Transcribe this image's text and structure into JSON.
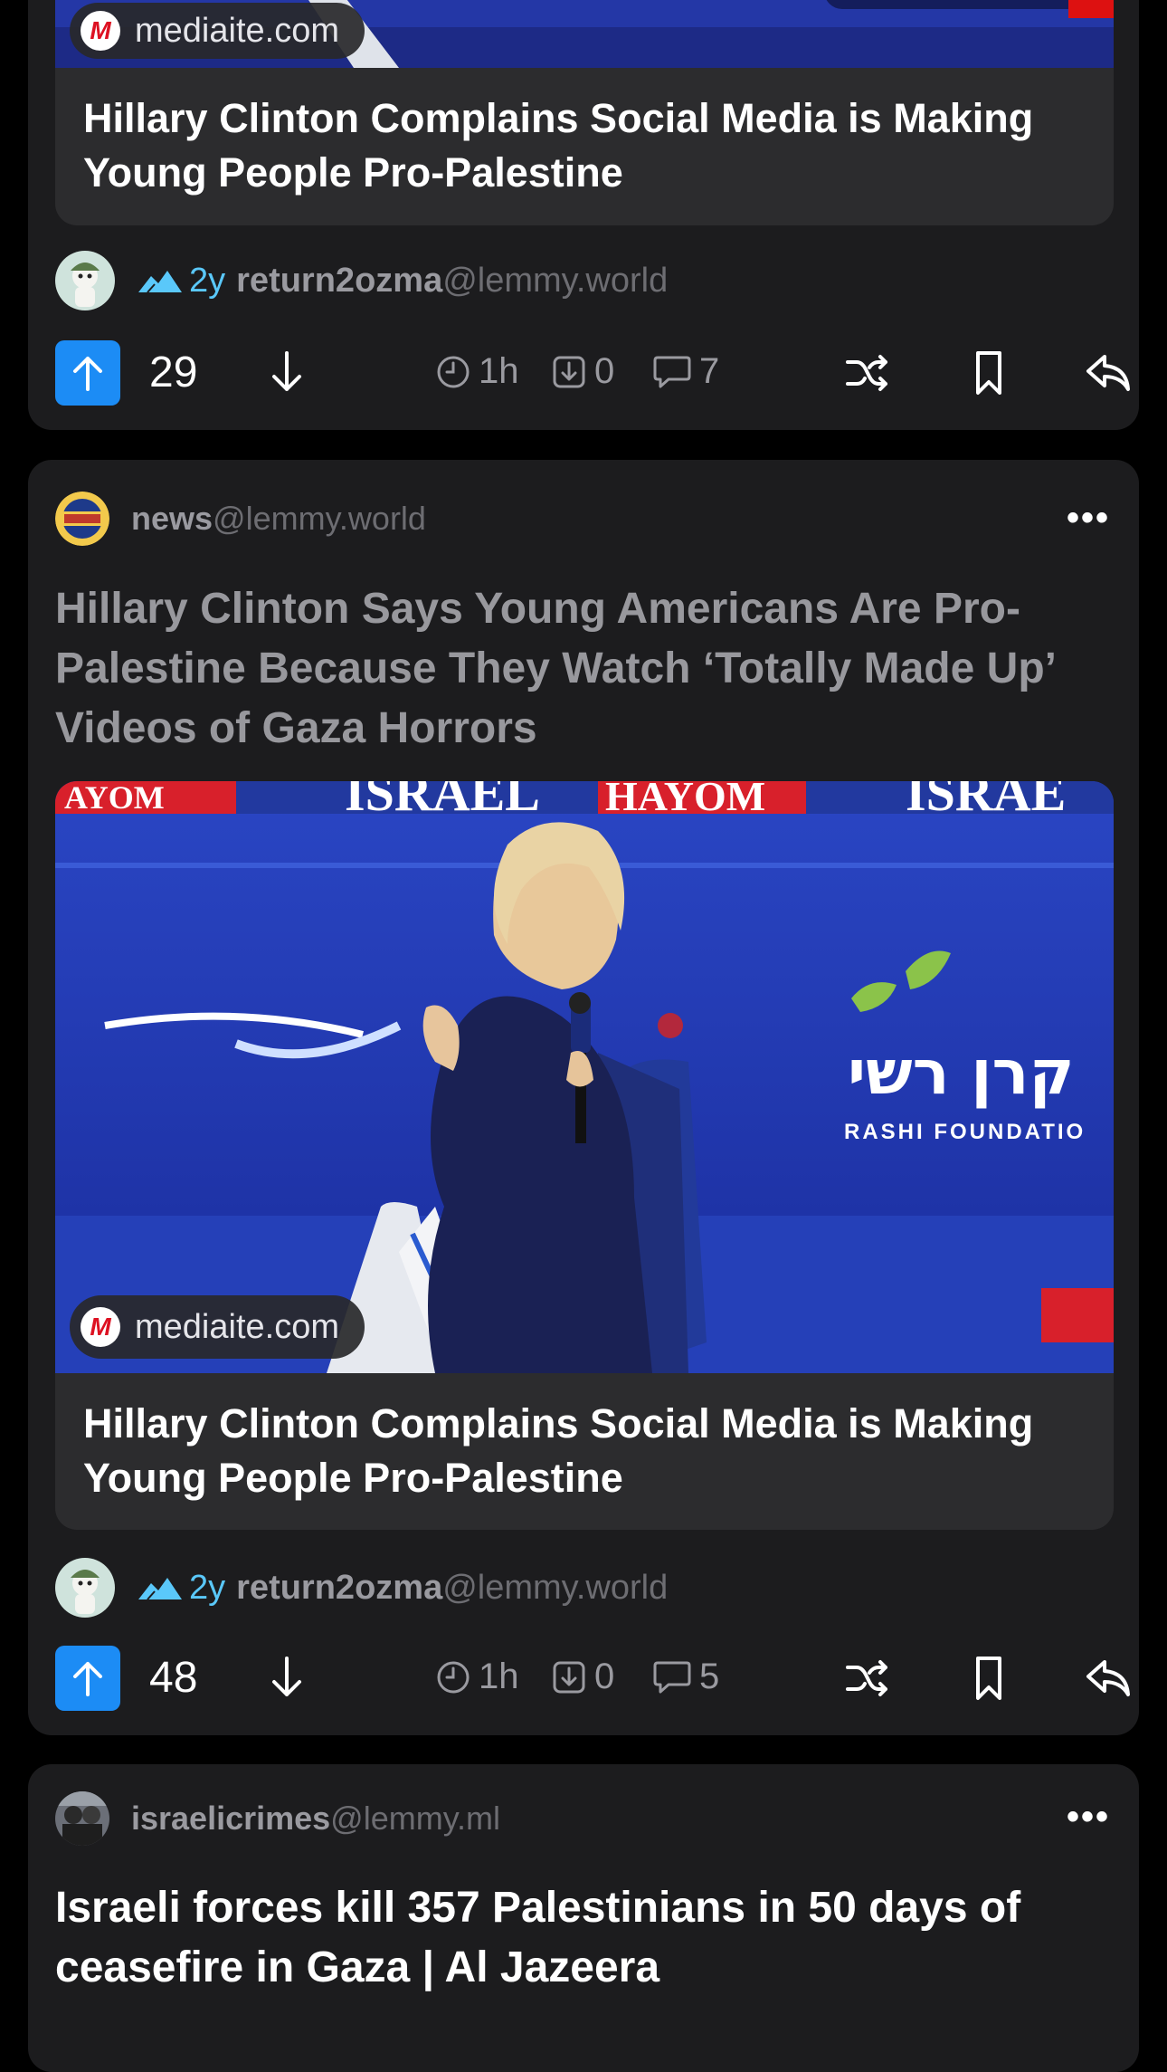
{
  "feed": {
    "posts": [
      {
        "community": {
          "name": "",
          "host": ""
        },
        "title": "",
        "image_domain": "mediaite.com",
        "link_title": "Hillary Clinton Complains Social Media is Making Young People Pro-Palestine",
        "age": "2y",
        "author": "return2ozma",
        "author_host": "@lemmy.world",
        "score": "29",
        "time": "1h",
        "saved_count": "0",
        "comments": "7"
      },
      {
        "community": {
          "name": "news",
          "host": "@lemmy.world"
        },
        "more_label": "•••",
        "title": "Hillary Clinton Says Young Americans Are Pro-Palestine Because They Watch ‘Totally Made Up’ Videos of Gaza Horrors",
        "image_domain": "mediaite.com",
        "image_texts": {
          "banner_left": "AYOM",
          "banner_mid_a": "ISRAEL",
          "banner_mid_b": "HAYOM",
          "banner_right": "ISRAE",
          "rashi_hebrew": "קרן רשי",
          "rashi_latin": "RASHI FOUNDATIO"
        },
        "link_title": "Hillary Clinton Complains Social Media is Making Young People Pro-Palestine",
        "age": "2y",
        "author": "return2ozma",
        "author_host": "@lemmy.world",
        "score": "48",
        "time": "1h",
        "saved_count": "0",
        "comments": "5"
      },
      {
        "community": {
          "name": "israelicrimes",
          "host": "@lemmy.ml"
        },
        "more_label": "•••",
        "title": "Israeli forces kill 357 Palestinians in 50 days of ceasefire in Gaza | Al Jazeera"
      }
    ]
  },
  "colors": {
    "background": "#000000",
    "card": "#1c1c1e",
    "upvote_accent": "#1c8cf5",
    "age_accent": "#5ac8fa",
    "secondary_text": "#9a9aa0"
  },
  "icons": [
    "mountains-icon",
    "arrow-up-icon",
    "arrow-down-icon",
    "clock-icon",
    "download-icon",
    "comment-icon",
    "shuffle-icon",
    "bookmark-icon",
    "reply-icon",
    "more-icon"
  ]
}
